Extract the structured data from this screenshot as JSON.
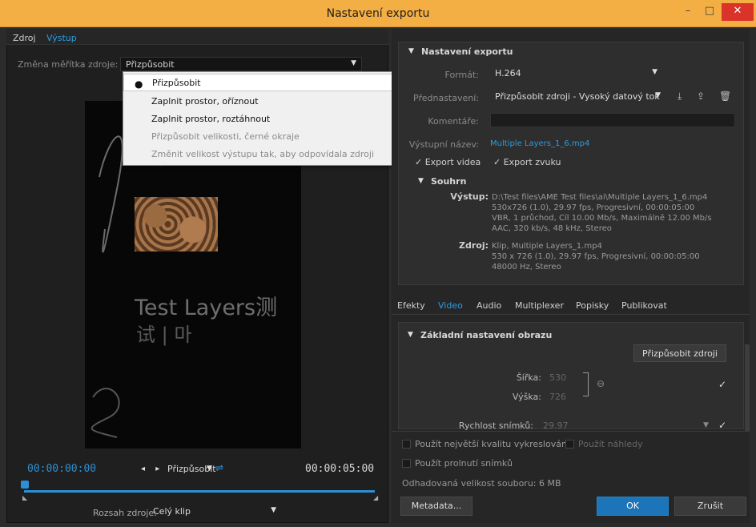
{
  "window": {
    "title": "Nastavení exportu",
    "min": "–",
    "max": "□",
    "close": "✕"
  },
  "left": {
    "tabs": [
      "Zdroj",
      "Výstup"
    ],
    "scale_label": "Změna měřítka zdroje:",
    "scale_value": "Přizpůsobit",
    "dropdown": [
      {
        "label": "Přizpůsobit",
        "state": "selected"
      },
      {
        "label": "Zaplnit prostor, oříznout",
        "state": "normal"
      },
      {
        "label": "Zaplnit prostor, roztáhnout",
        "state": "normal"
      },
      {
        "label": "Přizpůsobit velikosti, černé okraje",
        "state": "disabled"
      },
      {
        "label": "Změnit velikost výstupu tak, aby odpovídala zdroji",
        "state": "disabled"
      }
    ],
    "preview_text_1": "Test Layers测",
    "preview_text_2": "试 | 마",
    "timecode_start": "00:00:00:00",
    "timecode_end": "00:00:05:00",
    "fit_label": "Přizpůsobit",
    "range_label": "Rozsah zdroje:",
    "range_value": "Celý klip"
  },
  "export": {
    "heading": "Nastavení exportu",
    "format_label": "Formát:",
    "format_value": "H.264",
    "preset_label": "Přednastavení:",
    "preset_value": "Přizpůsobit zdroji - Vysoký datový tok",
    "comments_label": "Komentáře:",
    "comments_value": "",
    "output_label": "Výstupní název:",
    "output_value": "Multiple Layers_1_6.mp4",
    "export_video": "Export videa",
    "export_audio": "Export zvuku",
    "summary_heading": "Souhrn",
    "output_key": "Výstup:",
    "output_lines": [
      "D:\\Test files\\AME Test files\\ai\\Multiple Layers_1_6.mp4",
      "530x726 (1.0), 29.97 fps, Progresivní, 00:00:05:00",
      "VBR, 1 průchod, Cíl 10.00 Mb/s, Maximálně 12.00 Mb/s",
      "AAC, 320 kb/s, 48 kHz, Stereo"
    ],
    "source_key": "Zdroj:",
    "source_lines": [
      "Klip, Multiple Layers_1.mp4",
      "530 x 726 (1.0), 29.97 fps, Progresivní, 00:00:05:00",
      "48000 Hz, Stereo"
    ]
  },
  "tabs": [
    "Efekty",
    "Video",
    "Audio",
    "Multiplexer",
    "Popisky",
    "Publikovat"
  ],
  "video": {
    "heading": "Základní nastavení obrazu",
    "match_button": "Přizpůsobit zdroji",
    "width_label": "Šířka:",
    "width_value": "530",
    "height_label": "Výška:",
    "height_value": "726",
    "framerate_label": "Rychlost snímků:",
    "framerate_value": "29.97"
  },
  "bottom": {
    "max_quality": "Použít největší kvalitu vykreslování",
    "use_previews": "Použít náhledy",
    "frame_blend": "Použít prolnutí snímků",
    "file_size": "Odhadovaná velikost souboru:  6 MB",
    "metadata_button": "Metadata...",
    "ok_button": "OK",
    "cancel_button": "Zrušit"
  }
}
